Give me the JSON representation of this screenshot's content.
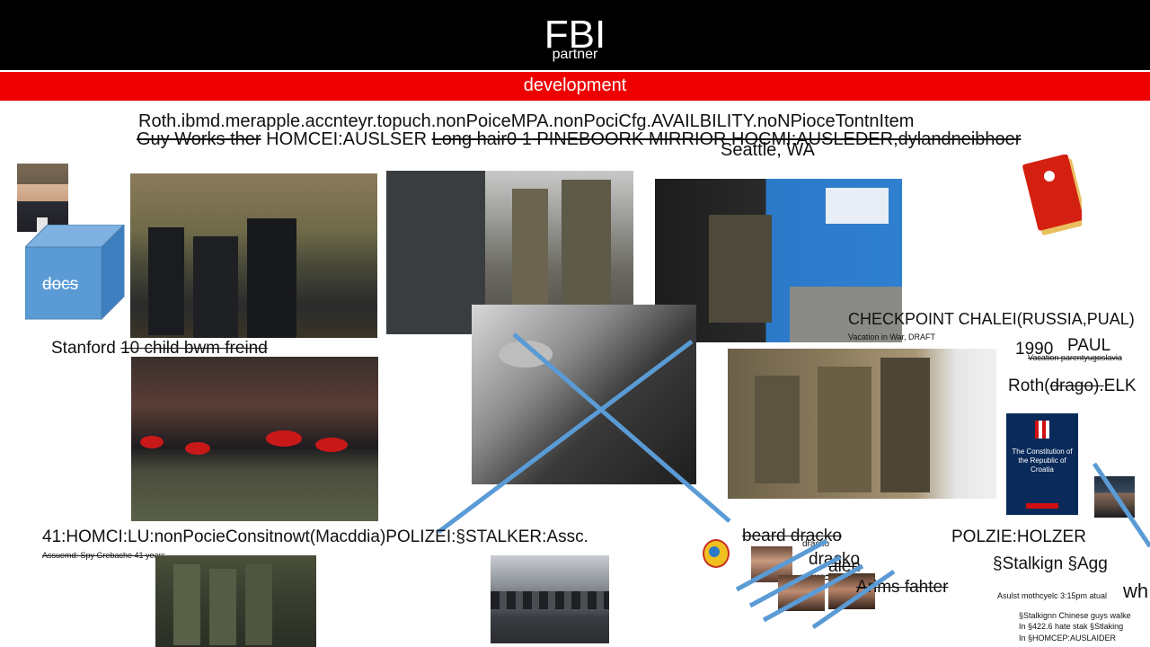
{
  "header": {
    "title": "FBI",
    "subtitle": "partner"
  },
  "band": {
    "label": "development"
  },
  "text": {
    "roth_ibmd": "Roth.ibmd.merapple.accnteyr.topuch.nonPoiceMPA.nonPociCfg.AVAILBILITY.noNPioceTontnItem",
    "guy_works_struck": "Guy Works ther",
    "homcei_ausl": " HOMCEI:AUSLSER ",
    "long_hair_struck": "Long hair0 1",
    "pineboork": "  PINEBOORK MIRRIOR HOCMI:AUSLEDER,dylandneibhoer",
    "seattle": "Seattle, WA",
    "docs": "docs",
    "stanford": "Stanford ",
    "ten_child": "10 child bwm freind",
    "checkpoint": "CHECKPOINT CHALEI(RUSSIA,PUAL)",
    "vacation_war": "Vacation in War, DRAFT",
    "year": "1990",
    "paul": "PAUL",
    "vacation_parent": "Vacation parentyugoslavia",
    "roth_prefix": "Roth(",
    "drago": "drago).",
    "elk": "ELK",
    "homci_lu": "41:HOMCI:LU:nonPocieConsitnowt(Macddia)POLIZEI:§STALKER:Assc.",
    "assuemd": "Assuemd: Spy Grebache 41 years",
    "beard_dracko": "beard dracko",
    "dracko_small": "dracko",
    "dracko_big": "dracko",
    "alen": "alen",
    "arim": "arim",
    "arims_fahter": "Arims fahter",
    "polzie": "POLZIE:HOLZER",
    "stalkign_agg": "§Stalkign §Agg",
    "wh": "wh",
    "asulst": "Asulst mothcyelc 3:15pm atual",
    "note1": "§Stalkignn Chinese guys walke",
    "note2": "In §422.6 hate stak §Stlaking",
    "note3": "In §HOMCEP:AUSLAIDER",
    "book_title": "The Constitution of the Republic of Croatia"
  },
  "colors": {
    "header_bg": "#000000",
    "band_bg": "#ee0000",
    "cube_face": "#5b9bd5",
    "cross_line": "#5b9bd5"
  }
}
